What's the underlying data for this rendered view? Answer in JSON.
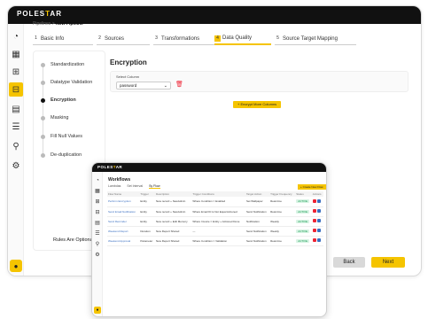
{
  "app": {
    "brand": "POLESTAR"
  },
  "breadcrumb": {
    "parent": "Pipelines",
    "separator": ">",
    "current": "New Pipeline"
  },
  "steps": [
    {
      "num": "1",
      "label": "Basic Info"
    },
    {
      "num": "2",
      "label": "Sources"
    },
    {
      "num": "3",
      "label": "Transformations"
    },
    {
      "num": "4",
      "label": "Data Quality"
    },
    {
      "num": "5",
      "label": "Source Target Mapping"
    }
  ],
  "rules": {
    "items": [
      "Standardization",
      "Datatype Validation",
      "Encryption",
      "Masking",
      "Fill Null Values",
      "De-duplication"
    ],
    "active": "Encryption",
    "optional_note": "Rules Are Optional"
  },
  "panel": {
    "title": "Encryption",
    "select_label": "Select Column",
    "select_value": "password",
    "add_button": "+ Encrypt More Columns"
  },
  "footer": {
    "back": "Back",
    "next": "Next"
  },
  "colors": {
    "accent": "#f5c400",
    "dark": "#111111",
    "danger": "#e22233"
  },
  "overlay": {
    "brand": "POLESTAR",
    "title": "Workflows",
    "tabs": [
      "Lambdas",
      "Set Interval",
      "Sy Flow"
    ],
    "create_button": "+ Create New Flow",
    "columns": [
      "Flow Name",
      "Trigger",
      "Description",
      "Trigger Conditions",
      "Target Action",
      "Trigger Frequency",
      "Status",
      "Actions"
    ],
    "rows": [
      {
        "name": "Perform Encryption",
        "trigger": "Entity",
        "desc": "New record + NewAdmin",
        "cond": "Where Condition = Enabled",
        "target": "Set Wallpaper",
        "freq": "Real-time",
        "status": "ACTIVE"
      },
      {
        "name": "Send Email Notification",
        "trigger": "Entity",
        "desc": "New record + NewAdmin",
        "cond": "Where Email ID is Not Equal Actioned",
        "target": "Send Notification",
        "freq": "Real-time",
        "status": "ACTIVE"
      },
      {
        "name": "Send Reminder",
        "trigger": "Entity",
        "desc": "New record + Edit Memory",
        "cond": "Where Invoice = Entity + Actioned Done",
        "target": "Notification",
        "freq": "Weekly",
        "status": "ACTIVE"
      },
      {
        "name": "Weekend Report",
        "trigger": "Duration",
        "desc": "New Report Shared",
        "cond": "—",
        "target": "Send Notification",
        "freq": "Weekly",
        "status": "ACTIVE"
      },
      {
        "name": "Weekend Approval",
        "trigger": "Parameter",
        "desc": "New Report Shared",
        "cond": "Where Condition = Validation",
        "target": "Send Notification",
        "freq": "Real-time",
        "status": "ACTIVE"
      }
    ]
  }
}
